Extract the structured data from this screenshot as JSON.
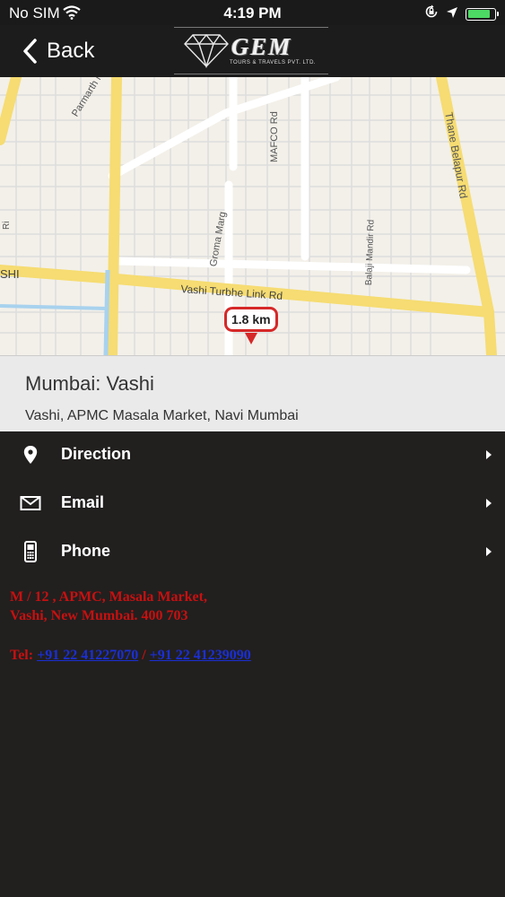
{
  "status_bar": {
    "carrier": "No SIM",
    "time": "4:19 PM",
    "battery_level": 0.76,
    "icons": [
      "wifi-icon",
      "orientation-lock-icon",
      "location-arrow-icon",
      "battery-icon"
    ]
  },
  "nav": {
    "back_label": "Back",
    "logo_brand": "GEM",
    "logo_subtitle": "TOURS & TRAVELS PVT. LTD."
  },
  "map": {
    "streets": [
      "Parmarth Niketan Marg",
      "MAFCO Rd",
      "Thane Belapur Rd",
      "Groma Marg",
      "Balaji Mandir Rd",
      "Vashi Turbhe Link Rd"
    ],
    "area_label": "SHI",
    "distance_label": "1.8 km",
    "colors": {
      "background": "#f3f0e9",
      "major_road": "#f6dc72",
      "block_line": "#dddddd"
    }
  },
  "location": {
    "city": "Mumbai: Vashi",
    "address": "Vashi, APMC Masala Market, Navi Mumbai"
  },
  "actions": [
    {
      "label": "Direction",
      "icon": "map-pin-icon"
    },
    {
      "label": "Email",
      "icon": "envelope-icon"
    },
    {
      "label": "Phone",
      "icon": "mobile-phone-icon"
    }
  ],
  "contact": {
    "address_line1": "M / 12 , APMC, Masala Market,",
    "address_line2": "Vashi, New Mumbai. 400 703",
    "tel_label": "Tel:",
    "phone1": "+91 22 41227070",
    "separator": "/",
    "phone2": "+91 22 41239090",
    "colors": {
      "text": "#c81010",
      "link": "#1a2fd6"
    }
  }
}
